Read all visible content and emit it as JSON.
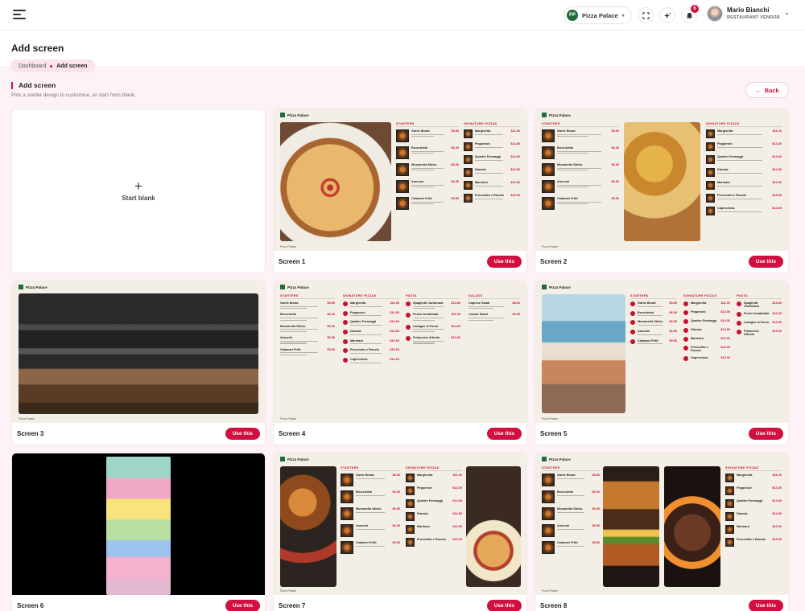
{
  "topbar": {
    "restaurant_name": "Pizza Palace",
    "restaurant_initials": "PP",
    "notifications_count": "6",
    "user_name": "Mario Bianchi",
    "user_role": "RESTAURANT VENDOR"
  },
  "page": {
    "title": "Add screen",
    "breadcrumb": [
      "Dashboard",
      "Add screen"
    ],
    "section_title": "Add screen",
    "section_subtitle": "Pick a starter design to customise, or start from blank.",
    "back_label": "Back",
    "start_blank_label": "Start blank",
    "use_button_label": "Use this"
  },
  "colors": {
    "accent": "#d2103f",
    "content_bg": "#fdf2f5"
  },
  "screens": [
    {
      "name": "Screen 1"
    },
    {
      "name": "Screen 2"
    },
    {
      "name": "Screen 3"
    },
    {
      "name": "Screen 4"
    },
    {
      "name": "Screen 5"
    },
    {
      "name": "Screen 6"
    },
    {
      "name": "Screen 7"
    },
    {
      "name": "Screen 8"
    }
  ],
  "preview_text": {
    "brand": "Pizza Palace",
    "starters": "STARTERS",
    "signature": "SIGNATURE PIZZAS",
    "pasta": "PASTA",
    "salads": "SALADS",
    "footer": "Pizza Palace",
    "items_starters": [
      {
        "name": "Garlic Bread",
        "price": "$5.50"
      },
      {
        "name": "Bruschetta",
        "price": "$6.00"
      },
      {
        "name": "Mozzarella Sticks",
        "price": "$6.50"
      },
      {
        "name": "Arancini",
        "price": "$6.50"
      },
      {
        "name": "Calamari Fritti",
        "price": "$5.50"
      }
    ],
    "items_pizzas": [
      {
        "name": "Margherita",
        "price": "$11.00"
      },
      {
        "name": "Pepperoni",
        "price": "$13.00"
      },
      {
        "name": "Quattro Formaggi",
        "price": "$14.00"
      },
      {
        "name": "Diavola",
        "price": "$14.50"
      },
      {
        "name": "Marinara",
        "price": "$10.00"
      },
      {
        "name": "Prosciutto e Rucola",
        "price": "$15.00"
      },
      {
        "name": "Capricciosa",
        "price": "$14.00"
      }
    ],
    "items_pasta": [
      {
        "name": "Spaghetti Carbonara",
        "price": "$13.00"
      },
      {
        "name": "Penne Arrabbiata",
        "price": "$11.00"
      },
      {
        "name": "Lasagne al Forno",
        "price": "$14.00"
      },
      {
        "name": "Fettuccine Alfredo",
        "price": "$13.00"
      }
    ],
    "items_salads": [
      {
        "name": "Caprese Salad",
        "price": "$8.00"
      },
      {
        "name": "Caesar Salad",
        "price": "$9.50"
      }
    ]
  }
}
